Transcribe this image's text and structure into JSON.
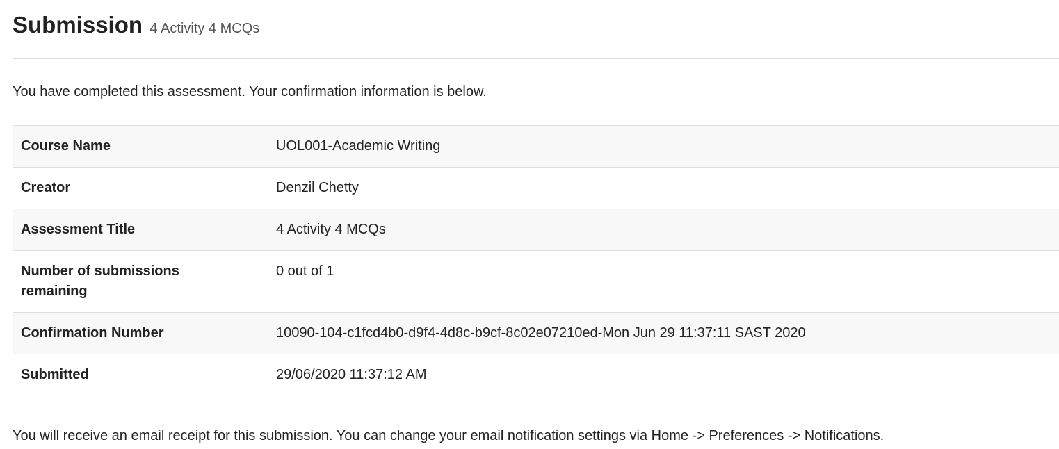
{
  "header": {
    "title": "Submission",
    "subtitle": "4 Activity 4 MCQs"
  },
  "intro": "You have completed this assessment. Your confirmation information is below.",
  "details": {
    "course_name": {
      "label": "Course Name",
      "value": "UOL001-Academic Writing"
    },
    "creator": {
      "label": "Creator",
      "value": "Denzil Chetty"
    },
    "assessment_title": {
      "label": "Assessment Title",
      "value": "4 Activity 4 MCQs"
    },
    "submissions_remaining": {
      "label": "Number of submissions remaining",
      "value": "0 out of 1"
    },
    "confirmation_number": {
      "label": "Confirmation Number",
      "value": "10090-104-c1fcd4b0-d9f4-4d8c-b9cf-8c02e07210ed-Mon Jun 29 11:37:11 SAST 2020"
    },
    "submitted": {
      "label": "Submitted",
      "value": "29/06/2020 11:37:12 AM"
    }
  },
  "footer_note": "You will receive an email receipt for this submission. You can change your email notification settings via Home -> Preferences -> Notifications."
}
